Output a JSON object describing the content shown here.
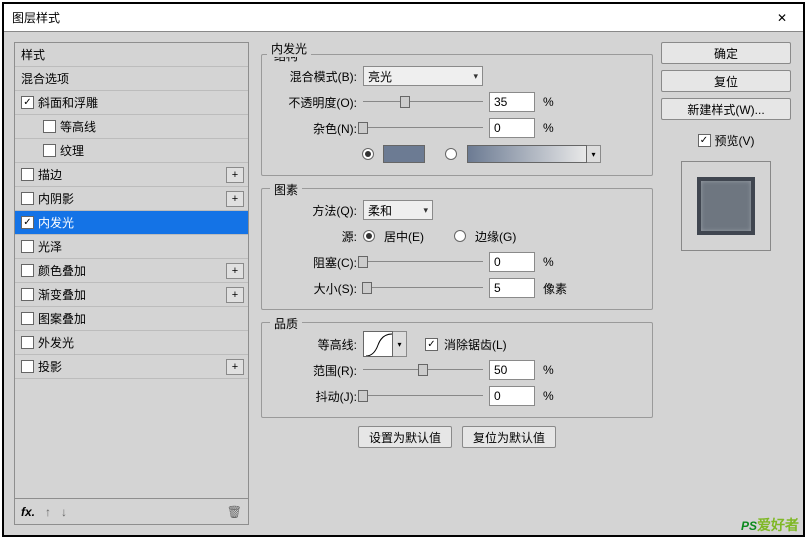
{
  "window": {
    "title": "图层样式",
    "close": "✕"
  },
  "sidebar": {
    "items": [
      {
        "label": "样式",
        "checkbox": false,
        "indent": 0,
        "plus": false
      },
      {
        "label": "混合选项",
        "checkbox": false,
        "indent": 0,
        "plus": false
      },
      {
        "label": "斜面和浮雕",
        "checkbox": true,
        "checked": true,
        "indent": 0,
        "plus": false
      },
      {
        "label": "等高线",
        "checkbox": true,
        "checked": false,
        "indent": 1,
        "plus": false
      },
      {
        "label": "纹理",
        "checkbox": true,
        "checked": false,
        "indent": 1,
        "plus": false
      },
      {
        "label": "描边",
        "checkbox": true,
        "checked": false,
        "indent": 0,
        "plus": true
      },
      {
        "label": "内阴影",
        "checkbox": true,
        "checked": false,
        "indent": 0,
        "plus": true
      },
      {
        "label": "内发光",
        "checkbox": true,
        "checked": true,
        "indent": 0,
        "plus": false,
        "selected": true
      },
      {
        "label": "光泽",
        "checkbox": true,
        "checked": false,
        "indent": 0,
        "plus": false
      },
      {
        "label": "颜色叠加",
        "checkbox": true,
        "checked": false,
        "indent": 0,
        "plus": true
      },
      {
        "label": "渐变叠加",
        "checkbox": true,
        "checked": false,
        "indent": 0,
        "plus": true
      },
      {
        "label": "图案叠加",
        "checkbox": true,
        "checked": false,
        "indent": 0,
        "plus": false
      },
      {
        "label": "外发光",
        "checkbox": true,
        "checked": false,
        "indent": 0,
        "plus": false
      },
      {
        "label": "投影",
        "checkbox": true,
        "checked": false,
        "indent": 0,
        "plus": true
      }
    ],
    "footer": {
      "fx": "fx.",
      "up": "↑",
      "down": "↓",
      "trash": "🗑"
    }
  },
  "main": {
    "title": "内发光",
    "struct": {
      "title": "结构",
      "blend_label": "混合模式(B):",
      "blend_value": "亮光",
      "opacity_label": "不透明度(O):",
      "opacity_value": "35",
      "opacity_unit": "%",
      "noise_label": "杂色(N):",
      "noise_value": "0",
      "noise_unit": "%"
    },
    "elements": {
      "title": "图素",
      "technique_label": "方法(Q):",
      "technique_value": "柔和",
      "source_label": "源:",
      "source_center": "居中(E)",
      "source_edge": "边缘(G)",
      "choke_label": "阻塞(C):",
      "choke_value": "0",
      "choke_unit": "%",
      "size_label": "大小(S):",
      "size_value": "5",
      "size_unit": "像素"
    },
    "quality": {
      "title": "品质",
      "contour_label": "等高线:",
      "antialias": "消除锯齿(L)",
      "range_label": "范围(R):",
      "range_value": "50",
      "range_unit": "%",
      "jitter_label": "抖动(J):",
      "jitter_value": "0",
      "jitter_unit": "%"
    },
    "buttons": {
      "default": "设置为默认值",
      "reset": "复位为默认值"
    }
  },
  "right": {
    "ok": "确定",
    "cancel": "复位",
    "newstyle": "新建样式(W)...",
    "preview": "预览(V)"
  },
  "watermark": {
    "ps": "PS",
    "cn": "爱好者"
  }
}
